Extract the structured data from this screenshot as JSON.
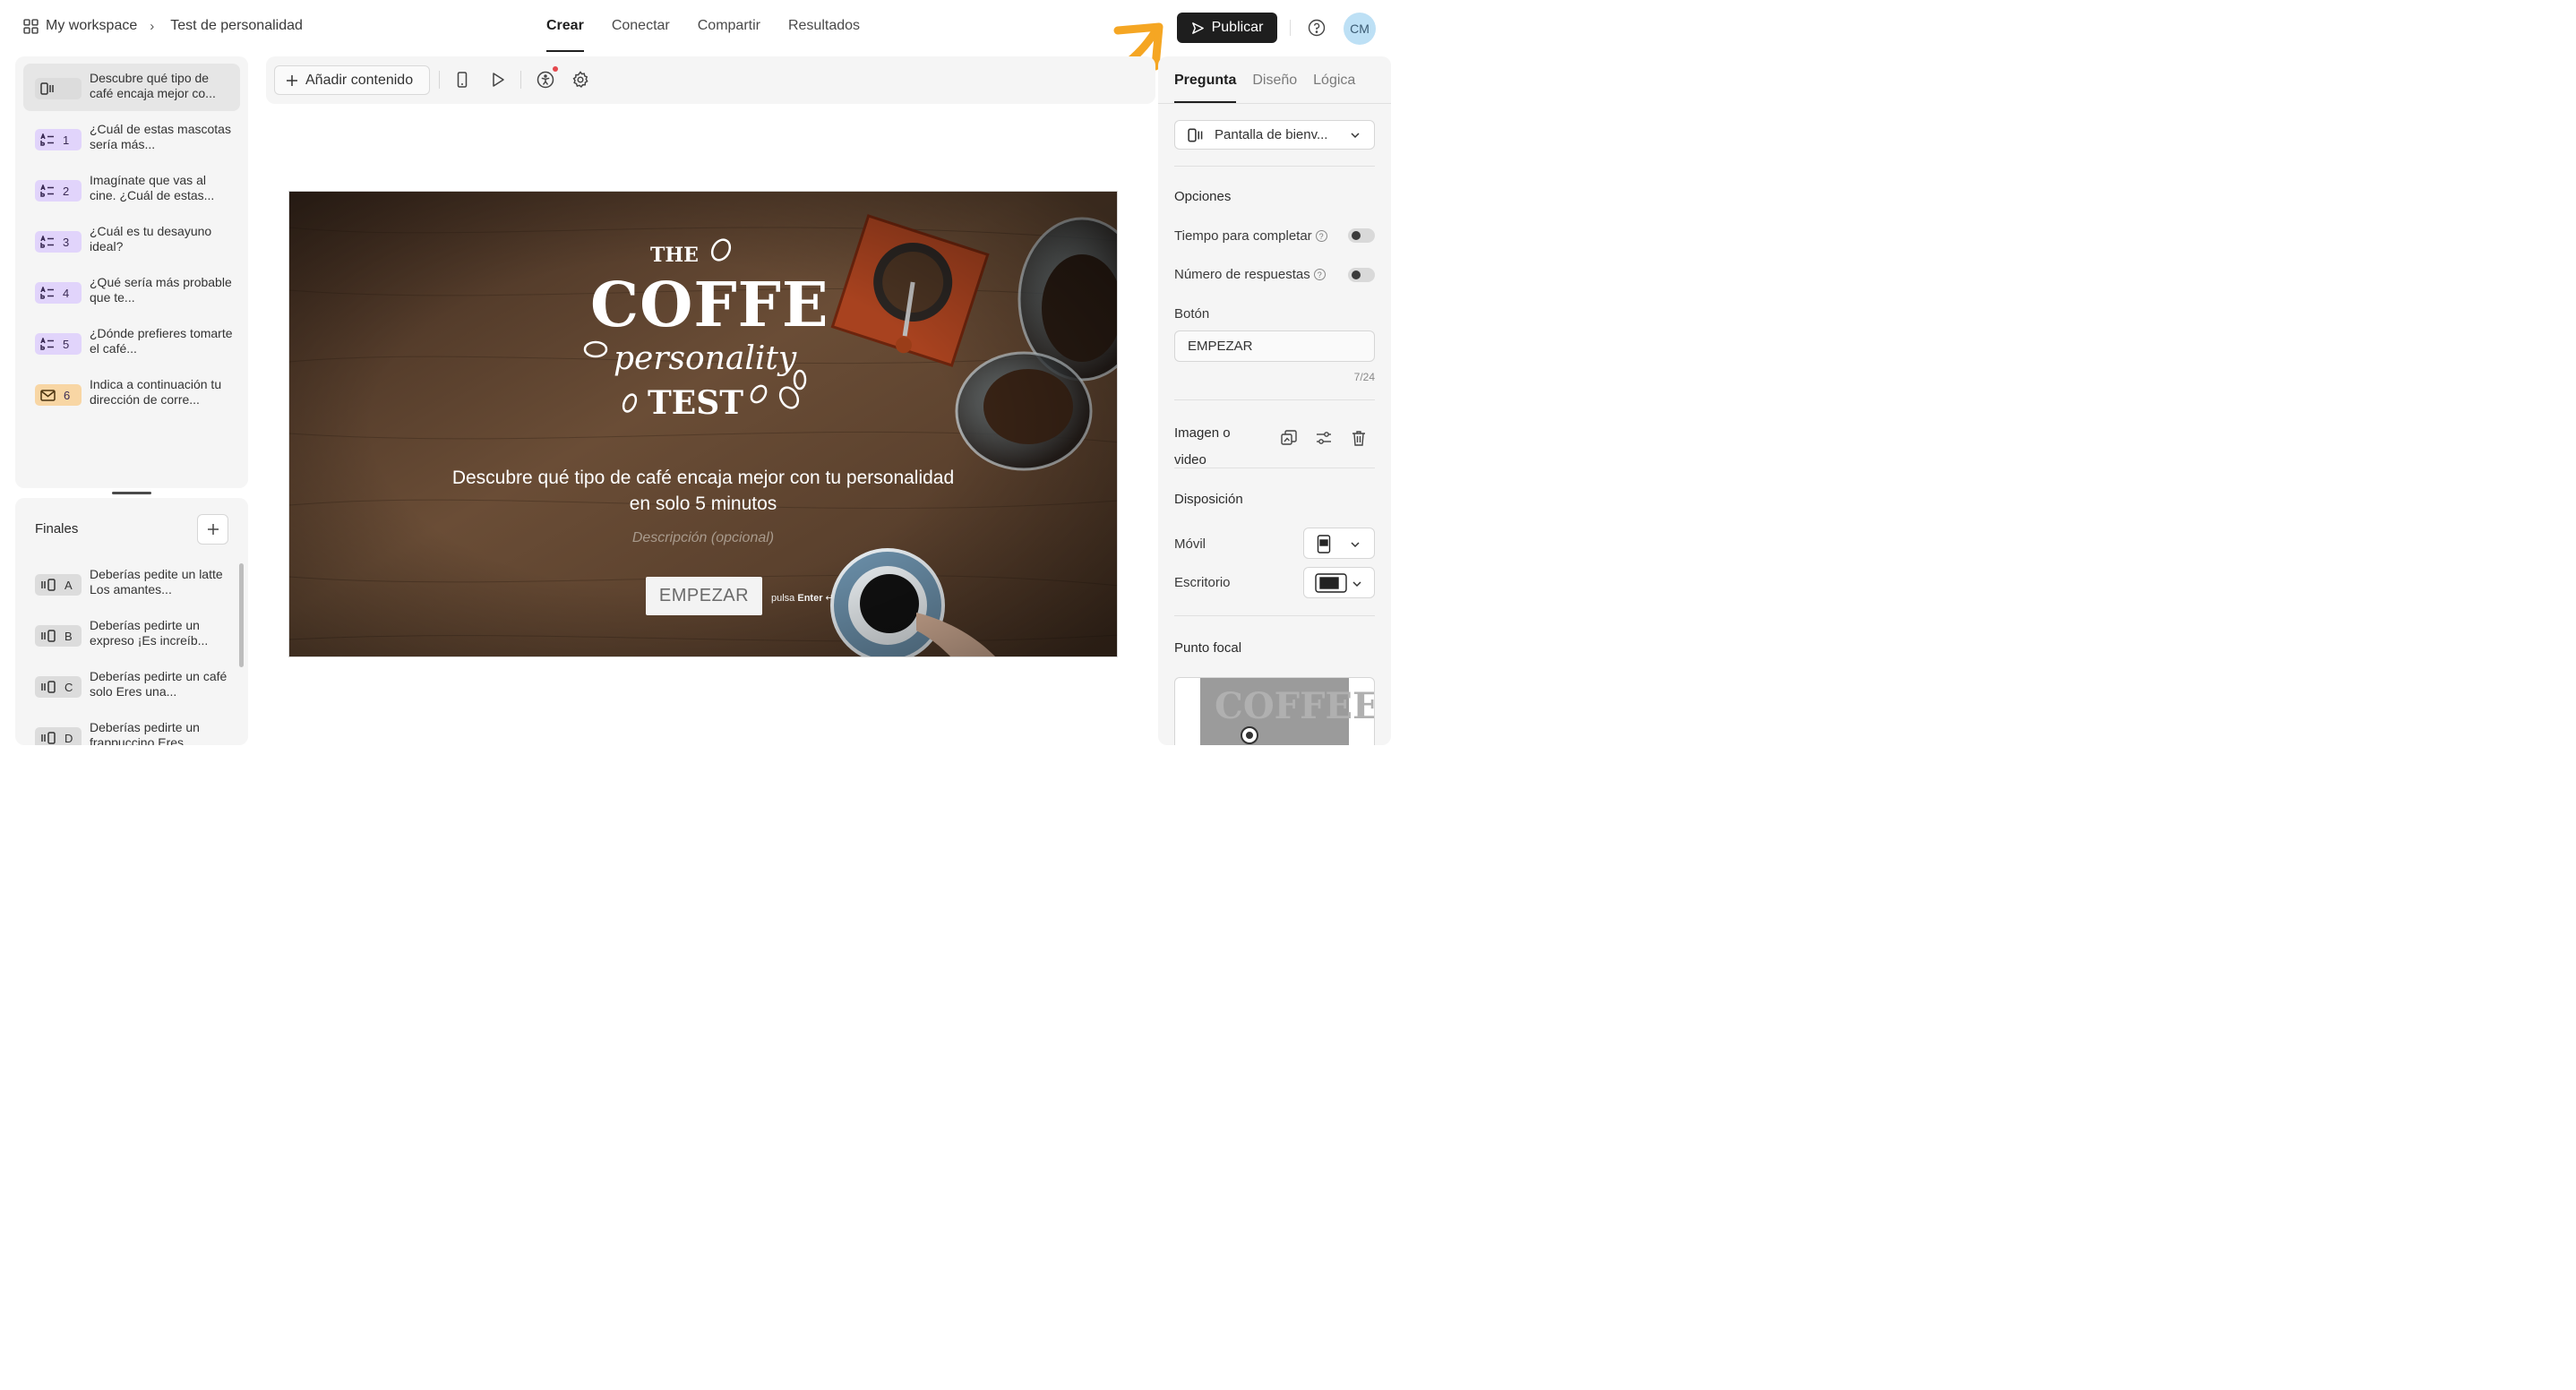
{
  "breadcrumb": {
    "workspace": "My workspace",
    "separator": "›",
    "form_name": "Test de personalidad"
  },
  "nav": {
    "tabs": [
      {
        "label": "Crear"
      },
      {
        "label": "Conectar"
      },
      {
        "label": "Compartir"
      },
      {
        "label": "Resultados"
      }
    ],
    "active": "Crear"
  },
  "actions": {
    "publish_label": "Publicar",
    "avatar_initials": "CM"
  },
  "questions": [
    {
      "type": "welcome-screen",
      "badge": "",
      "text": "Descubre qué tipo de café encaja mejor co..."
    },
    {
      "type": "multiple-choice",
      "badge": "1",
      "text": "¿Cuál de estas mascotas sería más..."
    },
    {
      "type": "multiple-choice",
      "badge": "2",
      "text": "Imagínate que vas al cine. ¿Cuál de estas..."
    },
    {
      "type": "multiple-choice",
      "badge": "3",
      "text": "¿Cuál es tu desayuno ideal?"
    },
    {
      "type": "multiple-choice",
      "badge": "4",
      "text": "¿Qué sería más probable que te..."
    },
    {
      "type": "multiple-choice",
      "badge": "5",
      "text": "¿Dónde prefieres tomarte el café..."
    },
    {
      "type": "email",
      "badge": "6",
      "text": "Indica a continuación tu dirección de corre..."
    }
  ],
  "endings": {
    "title": "Finales",
    "items": [
      {
        "badge": "A",
        "text": "Deberías pedite un latte Los amantes..."
      },
      {
        "badge": "B",
        "text": "Deberías pedirte un expreso ¡Es increíb..."
      },
      {
        "badge": "C",
        "text": "Deberías pedirte un café solo Eres una..."
      },
      {
        "badge": "D",
        "text": "Deberías pedirte un frappuccino Eres..."
      }
    ]
  },
  "toolbar": {
    "add_content_label": "Añadir contenido"
  },
  "canvas": {
    "logo": {
      "line1": "THE",
      "line2": "COFFEE",
      "line3": "personality",
      "line4": "TEST"
    },
    "headline_1": "Descubre qué tipo de café encaja mejor con tu personalidad",
    "headline_2": "en solo 5 minutos",
    "description_placeholder": "Descripción (opcional)",
    "button_label": "EMPEZAR",
    "hint_prefix": "pulsa",
    "hint_key": "Enter",
    "hint_symbol": "↵"
  },
  "settings": {
    "tabs": [
      {
        "label": "Pregunta"
      },
      {
        "label": "Diseño"
      },
      {
        "label": "Lógica"
      }
    ],
    "active_tab": "Pregunta",
    "question_type": "Pantalla de bienv...",
    "options_heading": "Opciones",
    "time_to_complete_label": "Tiempo para completar",
    "time_to_complete_enabled": false,
    "response_count_label": "Número de respuestas",
    "response_count_enabled": false,
    "button_heading": "Botón",
    "button_value": "EMPEZAR",
    "button_counter": "7/24",
    "media_heading_1": "Imagen o",
    "media_heading_2": "video",
    "layout_heading": "Disposición",
    "mobile_label": "Móvil",
    "desktop_label": "Escritorio",
    "focal_heading": "Punto focal"
  },
  "colors": {
    "publish_bg": "#1e1e1e",
    "avatar_bg": "#bde0f5",
    "arrow": "#f5a623",
    "mc_badge": "#e1d4fb",
    "email_badge": "#f8d6a4"
  }
}
